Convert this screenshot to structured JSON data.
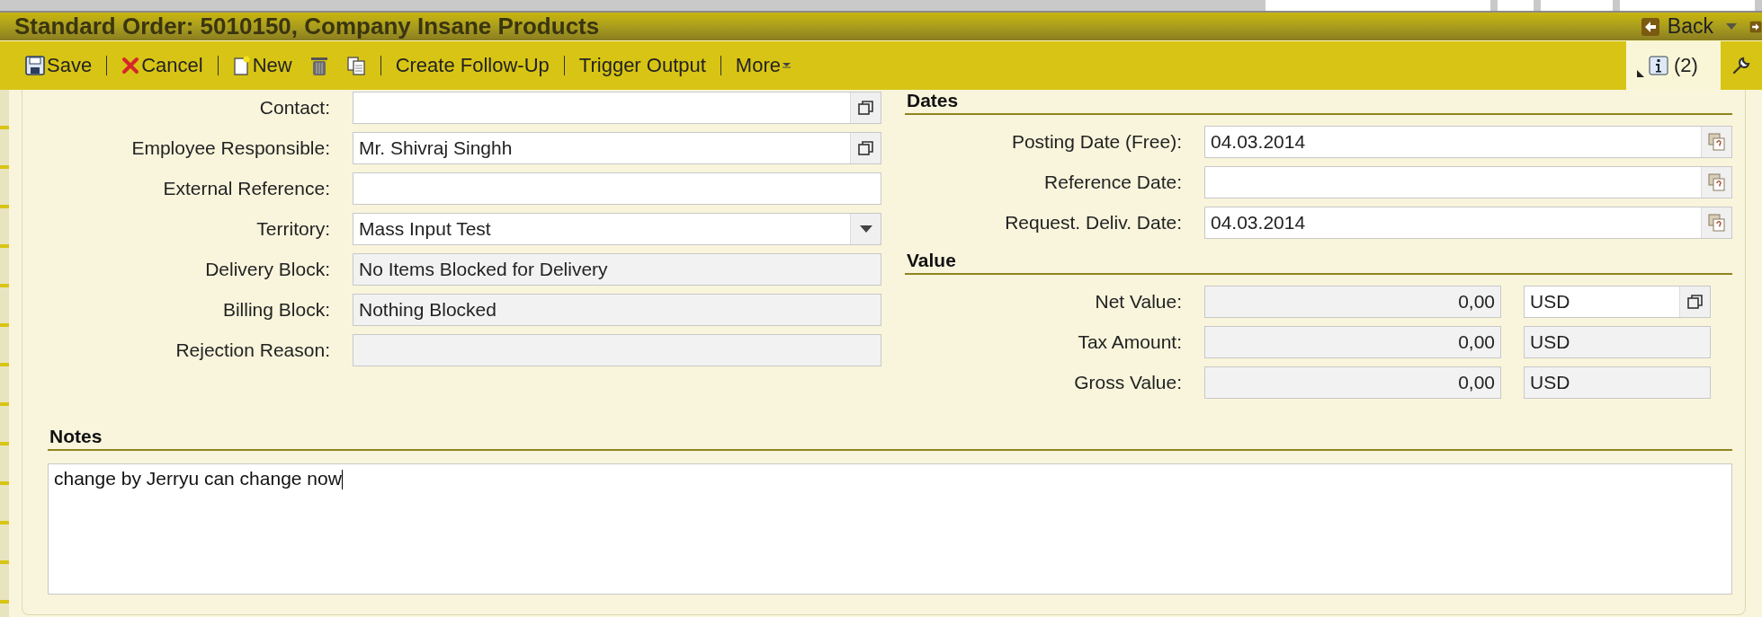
{
  "window": {
    "title": "Standard Order: 5010150, Company Insane Products"
  },
  "navigation": {
    "back": "Back"
  },
  "toolbar": [
    {
      "kind": "save",
      "label": "Save"
    },
    {
      "kind": "separator"
    },
    {
      "kind": "cancel",
      "label": "Cancel"
    },
    {
      "kind": "separator"
    },
    {
      "kind": "new",
      "label": "New"
    },
    {
      "kind": "delete"
    },
    {
      "kind": "copy"
    },
    {
      "kind": "separator"
    },
    {
      "kind": "text",
      "label": "Create Follow-Up"
    },
    {
      "kind": "separator"
    },
    {
      "kind": "text",
      "label": "Trigger Output"
    },
    {
      "kind": "separator"
    },
    {
      "kind": "menu",
      "label": "More"
    }
  ],
  "messages": {
    "count": "(2)"
  },
  "general_fields": [
    {
      "label": "Contact:",
      "kind": "lookup"
    },
    {
      "label": "Employee Responsible:",
      "kind": "lookup",
      "value": "Mr. Shivraj Singhh"
    },
    {
      "label": "External Reference:",
      "kind": "text"
    },
    {
      "label": "Territory:",
      "kind": "select",
      "value": "Mass Input Test"
    },
    {
      "label": "Delivery Block:",
      "kind": "readonly",
      "value": "No Items Blocked for Delivery"
    },
    {
      "label": "Billing Block:",
      "kind": "readonly",
      "value": "Nothing Blocked"
    },
    {
      "label": "Rejection Reason:",
      "kind": "readonly"
    }
  ],
  "dates": {
    "heading": "Dates",
    "fields": [
      {
        "label": "Posting Date (Free):",
        "value": "04.03.2014"
      },
      {
        "label": "Reference Date:"
      },
      {
        "label": "Request. Deliv. Date:",
        "value": "04.03.2014"
      }
    ]
  },
  "value": {
    "heading": "Value",
    "fields": [
      {
        "label": "Net Value:",
        "amount": "0,00",
        "currency": "USD",
        "kind": "lookup"
      },
      {
        "label": "Tax Amount:",
        "amount": "0,00",
        "currency": "USD",
        "kind": "readonly"
      },
      {
        "label": "Gross Value:",
        "amount": "0,00",
        "currency": "USD",
        "kind": "readonly"
      }
    ]
  },
  "notes": {
    "heading": "Notes",
    "text": "change by Jerryu can change now"
  }
}
